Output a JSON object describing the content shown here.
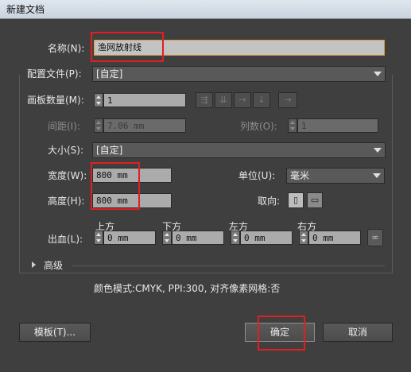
{
  "window": {
    "title": "新建文档"
  },
  "name": {
    "label": "名称(N):",
    "value": "渔网放射线"
  },
  "profile": {
    "label": "配置文件(P):",
    "value": "[自定]"
  },
  "artboards": {
    "count_label": "画板数量(M):",
    "count_value": "1",
    "spacing_label": "间距(I):",
    "spacing_value": "7.06 mm",
    "columns_label": "列数(O):",
    "columns_value": "1"
  },
  "size": {
    "label": "大小(S):",
    "value": "[自定]"
  },
  "width": {
    "label": "宽度(W):",
    "value": "800 mm"
  },
  "height": {
    "label": "高度(H):",
    "value": "800 mm"
  },
  "units": {
    "label": "单位(U):",
    "value": "毫米"
  },
  "orientation": {
    "label": "取向:"
  },
  "bleed": {
    "label": "出血(L):",
    "top_label": "上方",
    "top_value": "0 mm",
    "bottom_label": "下方",
    "bottom_value": "0 mm",
    "left_label": "左方",
    "left_value": "0 mm",
    "right_label": "右方",
    "right_value": "0 mm"
  },
  "advanced": {
    "label": "高级"
  },
  "info": {
    "text": "颜色模式:CMYK, PPI:300, 对齐像素网格:否"
  },
  "buttons": {
    "templates": "模板(T)...",
    "ok": "确定",
    "cancel": "取消"
  },
  "colors": {
    "background": "#3f3f3f",
    "highlight": "#e02020",
    "field": "#ababab"
  }
}
